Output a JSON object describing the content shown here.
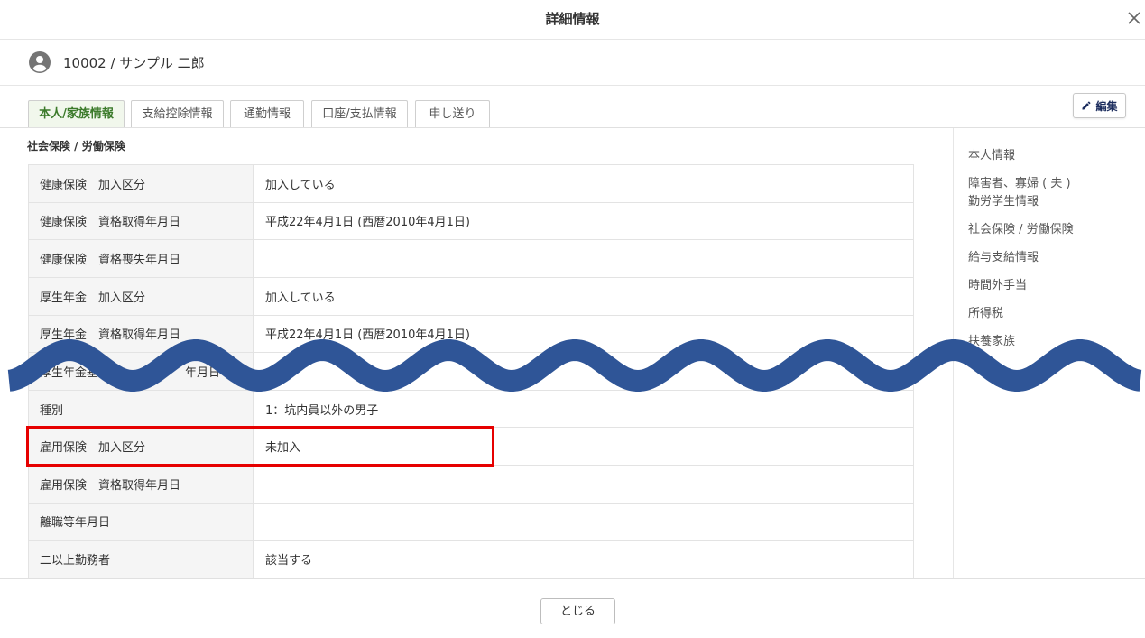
{
  "modal": {
    "title": "詳細情報"
  },
  "employee": {
    "label": "10002 / サンプル 二郎"
  },
  "tabs": [
    {
      "label": "本人/家族情報",
      "active": true
    },
    {
      "label": "支給控除情報",
      "active": false
    },
    {
      "label": "通勤情報",
      "active": false
    },
    {
      "label": "口座/支払情報",
      "active": false
    },
    {
      "label": "申し送り",
      "active": false
    }
  ],
  "toolbar": {
    "edit_label": "編集"
  },
  "section": {
    "title": "社会保険 / 労働保険",
    "rows": [
      {
        "label": "健康保険　加入区分",
        "value": "加入している"
      },
      {
        "label": "健康保険　資格取得年月日",
        "value": "平成22年4月1日 (西暦2010年4月1日)"
      },
      {
        "label": "健康保険　資格喪失年月日",
        "value": ""
      },
      {
        "label": "厚生年金　加入区分",
        "value": "加入している"
      },
      {
        "label": "厚生年金　資格取得年月日",
        "value": "平成22年4月1日 (西暦2010年4月1日)"
      },
      {
        "label": "厚生年金基",
        "label_tail": "年月日",
        "value": ""
      },
      {
        "label": "種別",
        "value": "1：坑内員以外の男子"
      },
      {
        "label": "雇用保険　加入区分",
        "value": "未加入",
        "highlighted": true
      },
      {
        "label": "雇用保険　資格取得年月日",
        "value": ""
      },
      {
        "label": "離職等年月日",
        "value": ""
      },
      {
        "label": "二以上勤務者",
        "value": "該当する"
      }
    ]
  },
  "side_nav": [
    {
      "lines": [
        "本人情報"
      ]
    },
    {
      "lines": [
        "障害者、寡婦 ( 夫 )",
        "勤労学生情報"
      ]
    },
    {
      "lines": [
        "社会保険 / 労働保険"
      ]
    },
    {
      "lines": [
        "給与支給情報"
      ]
    },
    {
      "lines": [
        "時間外手当"
      ]
    },
    {
      "lines": [
        "所得税"
      ]
    },
    {
      "lines": [
        "扶養家族"
      ]
    }
  ],
  "footer": {
    "close_label": "とじる"
  },
  "icons": {
    "close": "close-icon",
    "employee": "account-circle-icon",
    "edit": "pencil-icon"
  },
  "colors": {
    "active_tab_text": "#3b7a2a",
    "edit_text": "#1c2d5e",
    "highlight_border": "#e60000",
    "wave": "#2f5597"
  }
}
